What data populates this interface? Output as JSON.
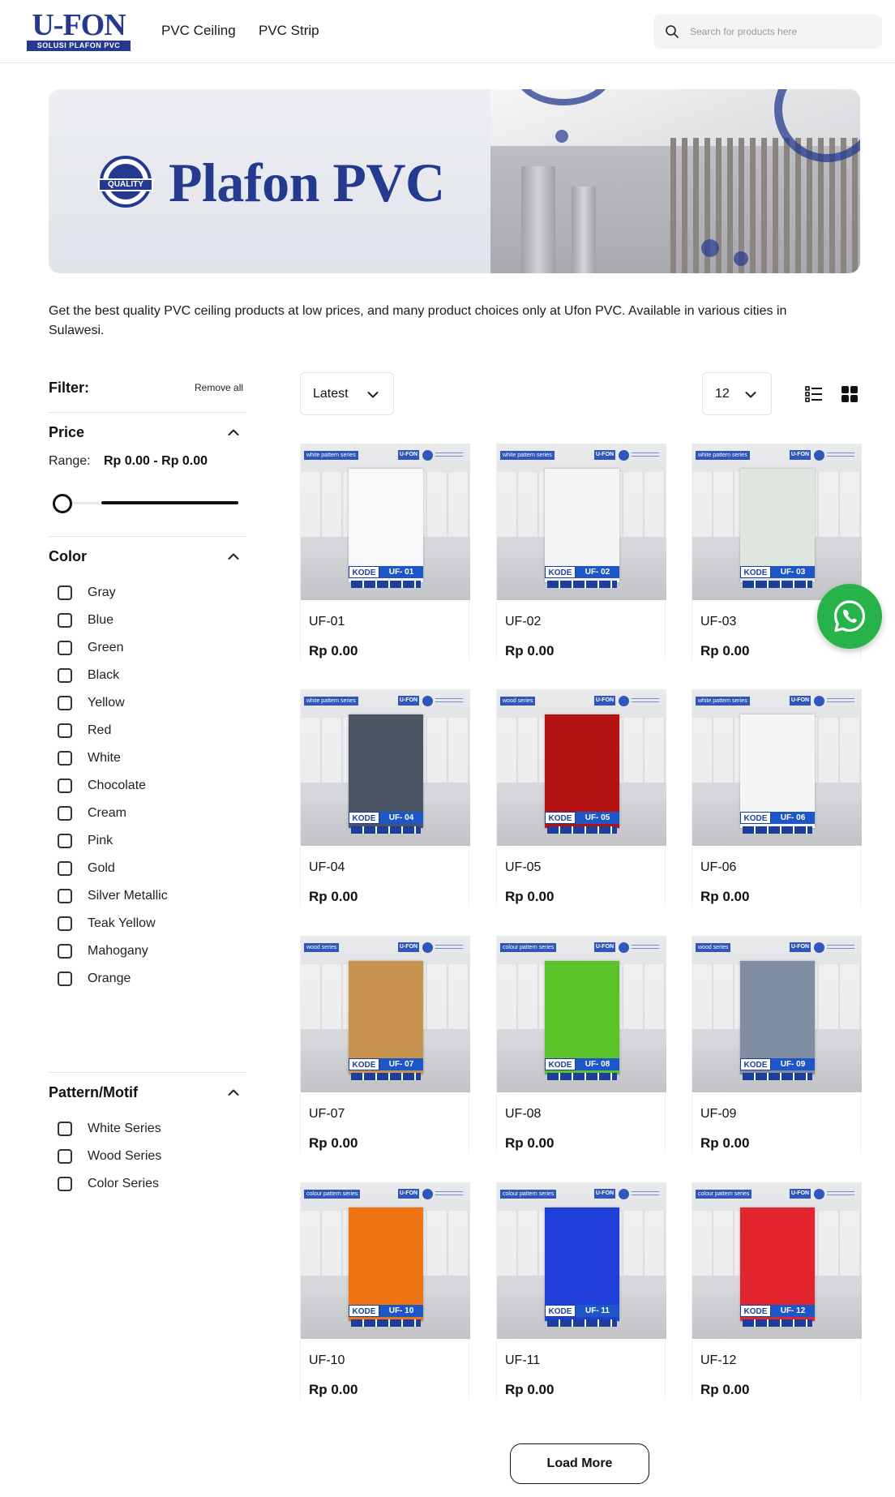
{
  "header": {
    "logo_word": "U-FON",
    "logo_sub": "SOLUSI PLAFON PVC",
    "nav": [
      {
        "label": "PVC Ceiling"
      },
      {
        "label": "PVC Strip"
      }
    ],
    "search_placeholder": "Search for products here"
  },
  "banner": {
    "badge_text": "QUALITY",
    "title": "Plafon PVC"
  },
  "intro": "Get the best quality PVC ceiling products at low prices, and many product choices only at Ufon PVC. Available in various cities in Sulawesi.",
  "filter": {
    "title": "Filter:",
    "remove_all": "Remove all",
    "price": {
      "title": "Price",
      "range_label": "Range:",
      "range_value": "Rp 0.00 - Rp 0.00"
    },
    "color": {
      "title": "Color",
      "options": [
        "Gray",
        "Blue",
        "Green",
        "Black",
        "Yellow",
        "Red",
        "White",
        "Chocolate",
        "Cream",
        "Pink",
        "Gold",
        "Silver Metallic",
        "Teak Yellow",
        "Mahogany",
        "Orange"
      ]
    },
    "pattern": {
      "title": "Pattern/Motif",
      "options": [
        "White Series",
        "Wood Series",
        "Color Series"
      ]
    }
  },
  "toolbar": {
    "sort_value": "Latest",
    "per_page_value": "12"
  },
  "products": [
    {
      "name": "UF-01",
      "price": "Rp 0.00",
      "series": "white pattern series",
      "code": "UF- 01",
      "panel": "#f7f8f9"
    },
    {
      "name": "UF-02",
      "price": "Rp 0.00",
      "series": "white pattern series",
      "code": "UF- 02",
      "panel": "#f3f4f6"
    },
    {
      "name": "UF-03",
      "price": "Rp 0.00",
      "series": "white pattern series",
      "code": "UF- 03",
      "panel": "#dfe6df"
    },
    {
      "name": "UF-04",
      "price": "Rp 0.00",
      "series": "white pattern series",
      "code": "UF- 04",
      "panel": "#4b5563"
    },
    {
      "name": "UF-05",
      "price": "Rp 0.00",
      "series": "wood series",
      "code": "UF- 05",
      "panel": "#b51212"
    },
    {
      "name": "UF-06",
      "price": "Rp 0.00",
      "series": "white pattern series",
      "code": "UF- 06",
      "panel": "#f4f5f7"
    },
    {
      "name": "UF-07",
      "price": "Rp 0.00",
      "series": "wood series",
      "code": "UF- 07",
      "panel": "#c8924f"
    },
    {
      "name": "UF-08",
      "price": "Rp 0.00",
      "series": "colour pattern series",
      "code": "UF- 08",
      "panel": "#5bc22a"
    },
    {
      "name": "UF-09",
      "price": "Rp 0.00",
      "series": "wood series",
      "code": "UF- 09",
      "panel": "#7f8ea3"
    },
    {
      "name": "UF-10",
      "price": "Rp 0.00",
      "series": "colour pattern series",
      "code": "UF- 10",
      "panel": "#f07314"
    },
    {
      "name": "UF-11",
      "price": "Rp 0.00",
      "series": "colour pattern series",
      "code": "UF- 11",
      "panel": "#1f3fd8"
    },
    {
      "name": "UF-12",
      "price": "Rp 0.00",
      "series": "colour pattern series",
      "code": "UF- 12",
      "panel": "#e3262e"
    }
  ],
  "product_brand_tag": "U-FON",
  "code_prefix": "KODE",
  "load_more": "Load More",
  "colors": {
    "brand": "#253a8e",
    "whatsapp": "#25b34a"
  }
}
